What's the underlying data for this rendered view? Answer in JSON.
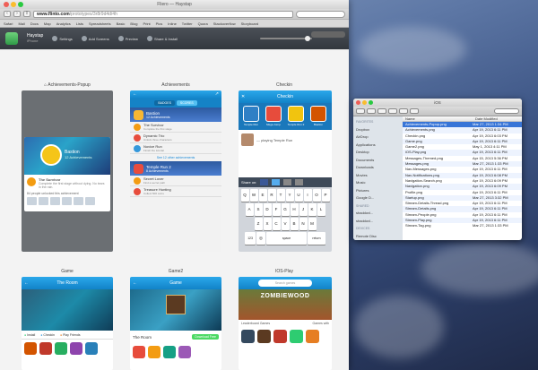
{
  "browser": {
    "window_title": "Fliero — Haystap",
    "url_host": "www.flinto.com",
    "url_path": "/prototypes/3r8r9d4d/4h",
    "bookmarks": [
      "Safari",
      "Mail",
      "Docs",
      "Map",
      "Analytics",
      "Lists",
      "Spreadsheets",
      "Basic",
      "Blog",
      "Print",
      "Pics",
      "Inline",
      "Twitter",
      "Quora",
      "Stackoverflow",
      "Storyboard"
    ]
  },
  "app": {
    "name": "Haystap",
    "subtitle": "iPhone",
    "nav": [
      "Settings",
      "Add Screens",
      "Preview",
      "Share & Install"
    ]
  },
  "screens": [
    {
      "label": "Achievements-Popup"
    },
    {
      "label": "Achievements"
    },
    {
      "label": "Checkin"
    },
    {
      "label": "Game"
    },
    {
      "label": "Game2"
    },
    {
      "label": "IOS-Play"
    }
  ],
  "achievements_popup": {
    "hero_title": "Bastion",
    "hero_sub": "12 Achievements",
    "item_title": "The Survivor",
    "item_desc": "Complete the first stage without dying. No tears in the rain.",
    "people": "84 people unlocked this achievement"
  },
  "achievements": {
    "title": "Bastion",
    "sub": "12 Achievements",
    "tabs": [
      "BADGES",
      "SCORES"
    ],
    "items": [
      {
        "name": "The Survivor",
        "desc": "Complete the first stage"
      },
      {
        "name": "Dynamic Trio",
        "desc": "Unlock three characters"
      },
      {
        "name": "Novice Run",
        "desc": "Finish the tutorial"
      }
    ],
    "section2": "Temple Run 2",
    "section2_sub": "8 Achievements",
    "items2": [
      {
        "name": "Secret Lover",
        "desc": "Find a secret path"
      },
      {
        "name": "Treasure Hunting",
        "desc": "Collect 500 coins"
      }
    ],
    "more": "See 12 other achievements"
  },
  "checkin": {
    "title": "Checkin",
    "games": [
      "Temple Run",
      "Mega Jump",
      "Temple Run 2",
      "Bastion"
    ],
    "status": "— playing Temple Run",
    "share_label": "Share on:",
    "keys_row1": [
      "Q",
      "W",
      "E",
      "R",
      "T",
      "Y",
      "U",
      "I",
      "O",
      "P"
    ],
    "keys_row2": [
      "A",
      "S",
      "D",
      "F",
      "G",
      "H",
      "J",
      "K",
      "L"
    ],
    "keys_row3": [
      "Z",
      "X",
      "C",
      "V",
      "B",
      "N",
      "M"
    ],
    "space": "space",
    "return": "return",
    "num": "123"
  },
  "game": {
    "title": "The Room",
    "install": "Install",
    "checkin": "Checkin",
    "play_friends": "Play Friends"
  },
  "game2": {
    "title": "Game",
    "name": "The Room",
    "price": "Download Free"
  },
  "iosplay": {
    "search": "Search games",
    "banner": "ZOMBIEWOOD",
    "leaderboard": "Leaderboard Games",
    "games_with": "Games with"
  },
  "finder": {
    "title": "iOS",
    "favorites_hd": "FAVORITES",
    "favorites": [
      "Dropbox",
      "AirDrop",
      "Applications",
      "Desktop",
      "Documents",
      "Downloads",
      "Movies",
      "Music",
      "Pictures",
      "Google D..."
    ],
    "shared_hd": "SHARED",
    "shared": [
      "shaddovl...",
      "shaddovl..."
    ],
    "devices_hd": "DEVICES",
    "devices": [
      "Remote Disc"
    ],
    "col_name": "Name",
    "col_date": "Date Modified",
    "files": [
      {
        "name": "Achievements-Popup.png",
        "date": "Mar 27, 2013 1:34 PM"
      },
      {
        "name": "Achievements.png",
        "date": "Apr 19, 2013 6:11 PM"
      },
      {
        "name": "Checkin.png",
        "date": "Apr 19, 2013 6:03 PM"
      },
      {
        "name": "Game.png",
        "date": "Apr 19, 2013 6:11 PM"
      },
      {
        "name": "Game2.png",
        "date": "May 1, 2013 4:11 PM"
      },
      {
        "name": "iOS-Play.png",
        "date": "Apr 19, 2013 6:11 PM"
      },
      {
        "name": "Messages-Themed.png",
        "date": "Apr 15, 2013 5:36 PM"
      },
      {
        "name": "Messages.png",
        "date": "Mar 27, 2013 1:33 PM"
      },
      {
        "name": "Nav-Messages.png",
        "date": "Apr 19, 2013 6:11 PM"
      },
      {
        "name": "Nav-Notifications.png",
        "date": "Apr 19, 2013 6:08 PM"
      },
      {
        "name": "Navigation-Search.png",
        "date": "Apr 19, 2013 6:09 PM"
      },
      {
        "name": "Navigation.png",
        "date": "Apr 19, 2013 6:09 PM"
      },
      {
        "name": "Profile.png",
        "date": "Apr 19, 2013 6:11 PM"
      },
      {
        "name": "Startup.png",
        "date": "Mar 27, 2013 3:32 PM"
      },
      {
        "name": "Stream-Details-Thread.png",
        "date": "Apr 19, 2013 6:11 PM"
      },
      {
        "name": "Stream-Details.png",
        "date": "Apr 19, 2013 6:11 PM"
      },
      {
        "name": "Stream-People.png",
        "date": "Apr 19, 2013 6:11 PM"
      },
      {
        "name": "Stream-Play.png",
        "date": "Apr 19, 2013 6:11 PM"
      },
      {
        "name": "Stream-Tag.png",
        "date": "Mar 27, 2013 1:33 PM"
      }
    ]
  }
}
